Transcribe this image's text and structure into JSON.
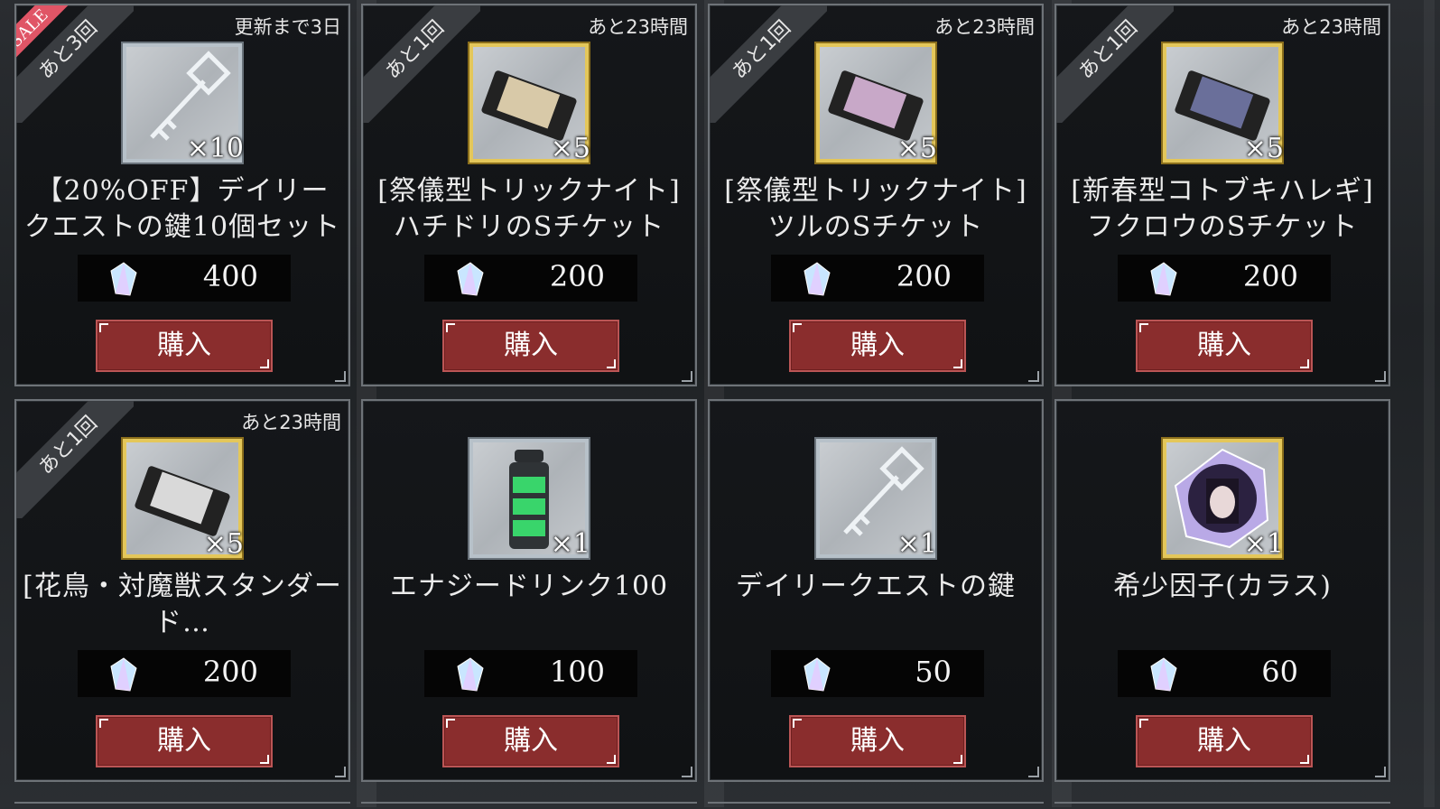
{
  "colors": {
    "buy_button": "#8a2d2d",
    "sale_ribbon": "#e05566",
    "gold_frame": "#e4c75a",
    "silver_frame": "#b7c1c9"
  },
  "buy_label": "購入",
  "items": [
    {
      "ribbon": "あと3回",
      "sale": "SALE",
      "timer": "更新まで3日",
      "icon": "key-icon",
      "frame": "silver",
      "qty": "×10",
      "name_line1": "【20%OFF】デイリー",
      "name_line2": "クエストの鍵10個セット",
      "price": "400"
    },
    {
      "ribbon": "あと1回",
      "timer": "あと23時間",
      "icon": "character-ticket-icon",
      "frame": "gold",
      "qty": "×5",
      "name_line1": "[祭儀型トリックナイト]",
      "name_line2": "ハチドリのSチケット",
      "price": "200"
    },
    {
      "ribbon": "あと1回",
      "timer": "あと23時間",
      "icon": "character-ticket-icon",
      "frame": "gold",
      "qty": "×5",
      "name_line1": "[祭儀型トリックナイト]",
      "name_line2": "ツルのSチケット",
      "price": "200"
    },
    {
      "ribbon": "あと1回",
      "timer": "あと23時間",
      "icon": "character-ticket-icon",
      "frame": "gold",
      "qty": "×5",
      "name_line1": "[新春型コトブキハレギ]",
      "name_line2": "フクロウのSチケット",
      "price": "200"
    },
    {
      "ribbon": "あと1回",
      "timer": "あと23時間",
      "icon": "character-ticket-icon",
      "frame": "gold",
      "qty": "×5",
      "name_line1": "[花鳥・対魔獣スタンダー",
      "name_line2": "ド…",
      "price": "200"
    },
    {
      "icon": "energy-drink-icon",
      "frame": "silver",
      "qty": "×1",
      "name_line1": "エナジードリンク100",
      "name_line2": "",
      "price": "100"
    },
    {
      "icon": "key-icon",
      "frame": "silver",
      "qty": "×1",
      "name_line1": "デイリークエストの鍵",
      "name_line2": "",
      "price": "50"
    },
    {
      "icon": "rare-gene-crystal-icon",
      "frame": "gold",
      "qty": "×1",
      "name_line1": "希少因子(カラス)",
      "name_line2": "",
      "price": "60"
    }
  ]
}
